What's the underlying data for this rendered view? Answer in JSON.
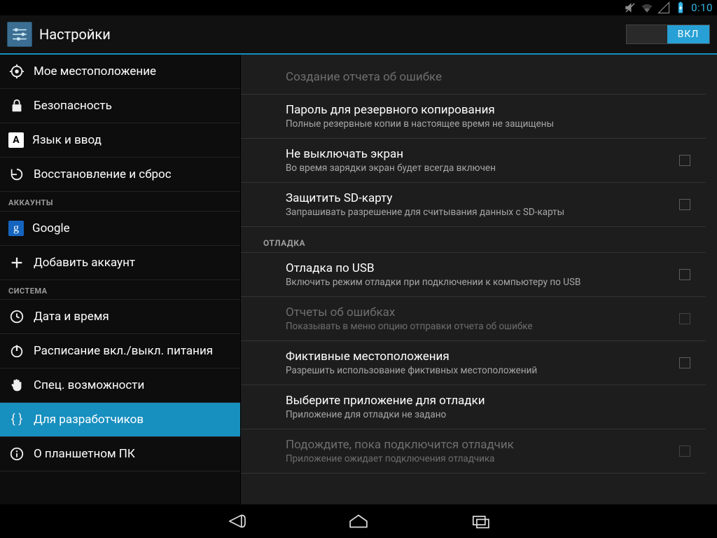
{
  "status": {
    "time": "0:10"
  },
  "actionbar": {
    "title": "Настройки",
    "switch_on_label": "ВКЛ"
  },
  "sidebar": {
    "items": [
      {
        "label": "Мое местоположение",
        "icon": "location"
      },
      {
        "label": "Безопасность",
        "icon": "lock"
      },
      {
        "label": "Язык и ввод",
        "icon": "language"
      },
      {
        "label": "Восстановление и сброс",
        "icon": "backup"
      }
    ],
    "section_accounts": "АККАУНТЫ",
    "accounts": [
      {
        "label": "Google",
        "icon": "google"
      },
      {
        "label": "Добавить аккаунт",
        "icon": "plus"
      }
    ],
    "section_system": "СИСТЕМА",
    "system": [
      {
        "label": "Дата и время",
        "icon": "clock"
      },
      {
        "label": "Расписание вкл./выкл. питания",
        "icon": "power"
      },
      {
        "label": "Спец. возможности",
        "icon": "hand"
      },
      {
        "label": "Для разработчиков",
        "icon": "braces",
        "selected": true
      },
      {
        "label": "О планшетном ПК",
        "icon": "info"
      }
    ]
  },
  "content": {
    "rows": [
      {
        "title": "Создание отчета об ошибке",
        "sub": "",
        "disabled": true
      },
      {
        "title": "Пароль для резервного копирования",
        "sub": "Полные резервные копии в настоящее время не защищены"
      },
      {
        "title": "Не выключать экран",
        "sub": "Во время зарядки экран будет всегда включен",
        "checkbox": true
      },
      {
        "title": "Защитить SD-карту",
        "sub": "Запрашивать разрешение для считывания данных с SD-карты",
        "checkbox": true
      }
    ],
    "section_debug": "ОТЛАДКА",
    "debug_rows": [
      {
        "title": "Отладка по USB",
        "sub": "Включить режим отладки при подключении к компьютеру по USB",
        "checkbox": true
      },
      {
        "title": "Отчеты об ошибках",
        "sub": "Показывать в меню опцию отправки отчета об ошибке",
        "checkbox": true,
        "disabled": true
      },
      {
        "title": "Фиктивные местоположения",
        "sub": "Разрешить использование фиктивных местоположений",
        "checkbox": true
      },
      {
        "title": "Выберите приложение для отладки",
        "sub": "Приложение для отладки не задано"
      },
      {
        "title": "Подождите, пока подключится отладчик",
        "sub": "Приложение ожидает подключения отладчика",
        "checkbox": true,
        "disabled": true
      }
    ]
  }
}
